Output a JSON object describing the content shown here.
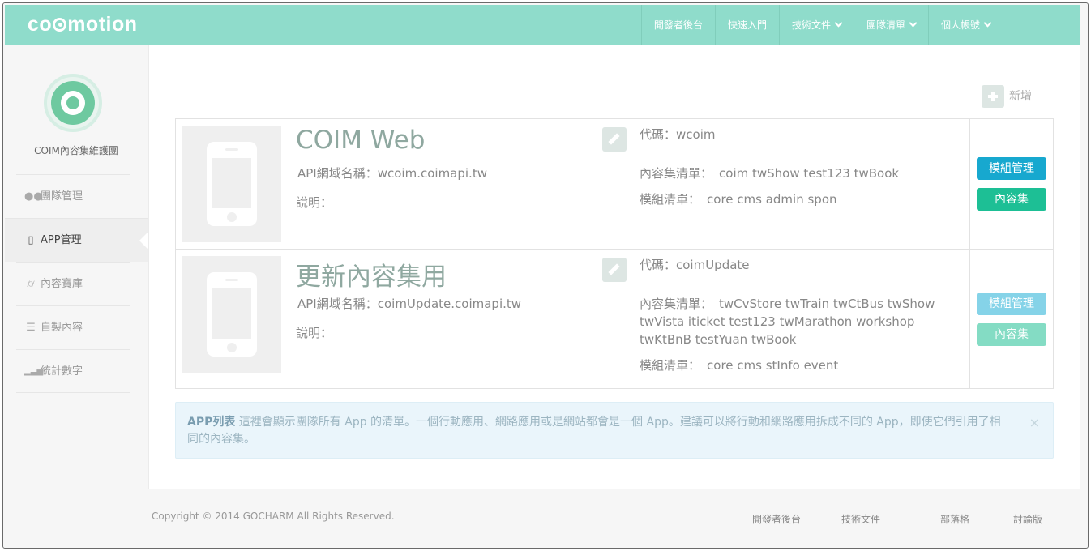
{
  "header": {
    "logo": "coimotion",
    "nav": [
      {
        "label": "開發者後台",
        "dropdown": false
      },
      {
        "label": "快速入門",
        "dropdown": false
      },
      {
        "label": "技術文件",
        "dropdown": true
      },
      {
        "label": "團隊清單",
        "dropdown": true
      },
      {
        "label": "個人帳號",
        "dropdown": true
      }
    ]
  },
  "sidebar": {
    "team_name": "COIM內容集維護團",
    "items": [
      {
        "label": "團隊管理",
        "icon": "team-icon"
      },
      {
        "label": "APP管理",
        "icon": "mobile-icon",
        "active": true
      },
      {
        "label": "內容寶庫",
        "icon": "inbox-icon"
      },
      {
        "label": "自製內容",
        "icon": "database-icon"
      },
      {
        "label": "統計數字",
        "icon": "signal-icon"
      }
    ]
  },
  "main": {
    "add_label": "新增",
    "apps": [
      {
        "title": "COIM Web",
        "domain": "API網域名稱：wcoim.coimapi.tw",
        "desc": "說明：",
        "code": "代碼：wcoim",
        "contentsets_label": "內容集清單：",
        "contentsets": "coim twShow test123 twBook",
        "modules_label": "模組清單：",
        "modules": "core cms admin spon",
        "btn_modules": "模組管理",
        "btn_contents": "內容集"
      },
      {
        "title": "更新內容集用",
        "domain": "API網域名稱：coimUpdate.coimapi.tw",
        "desc": "說明：",
        "code": "代碼：coimUpdate",
        "contentsets_label": "內容集清單：",
        "contentsets": "twCvStore twTrain twCtBus twShow twVista iticket test123 twMarathon workshop twKtBnB testYuan twBook",
        "modules_label": "模組清單：",
        "modules": "core cms stInfo event",
        "btn_modules": "模組管理",
        "btn_contents": "內容集"
      }
    ],
    "notice": {
      "title": "APP列表",
      "text": " 這裡會顯示團隊所有 App 的清單。一個行動應用、網路應用或是網站都會是一個 App。建議可以將行動和網路應用拆成不同的 App，即使它們引用了相同的內容集。",
      "close": "×"
    }
  },
  "footer": {
    "copyright": "Copyright © 2014 GOCHARM All Rights Reserved.",
    "links": [
      "開發者後台",
      "技術文件",
      "部落格",
      "討論版"
    ]
  },
  "colors": {
    "header": "#8fdccb",
    "btn_blue": "#17a8cf",
    "btn_green": "#1dbf95"
  }
}
